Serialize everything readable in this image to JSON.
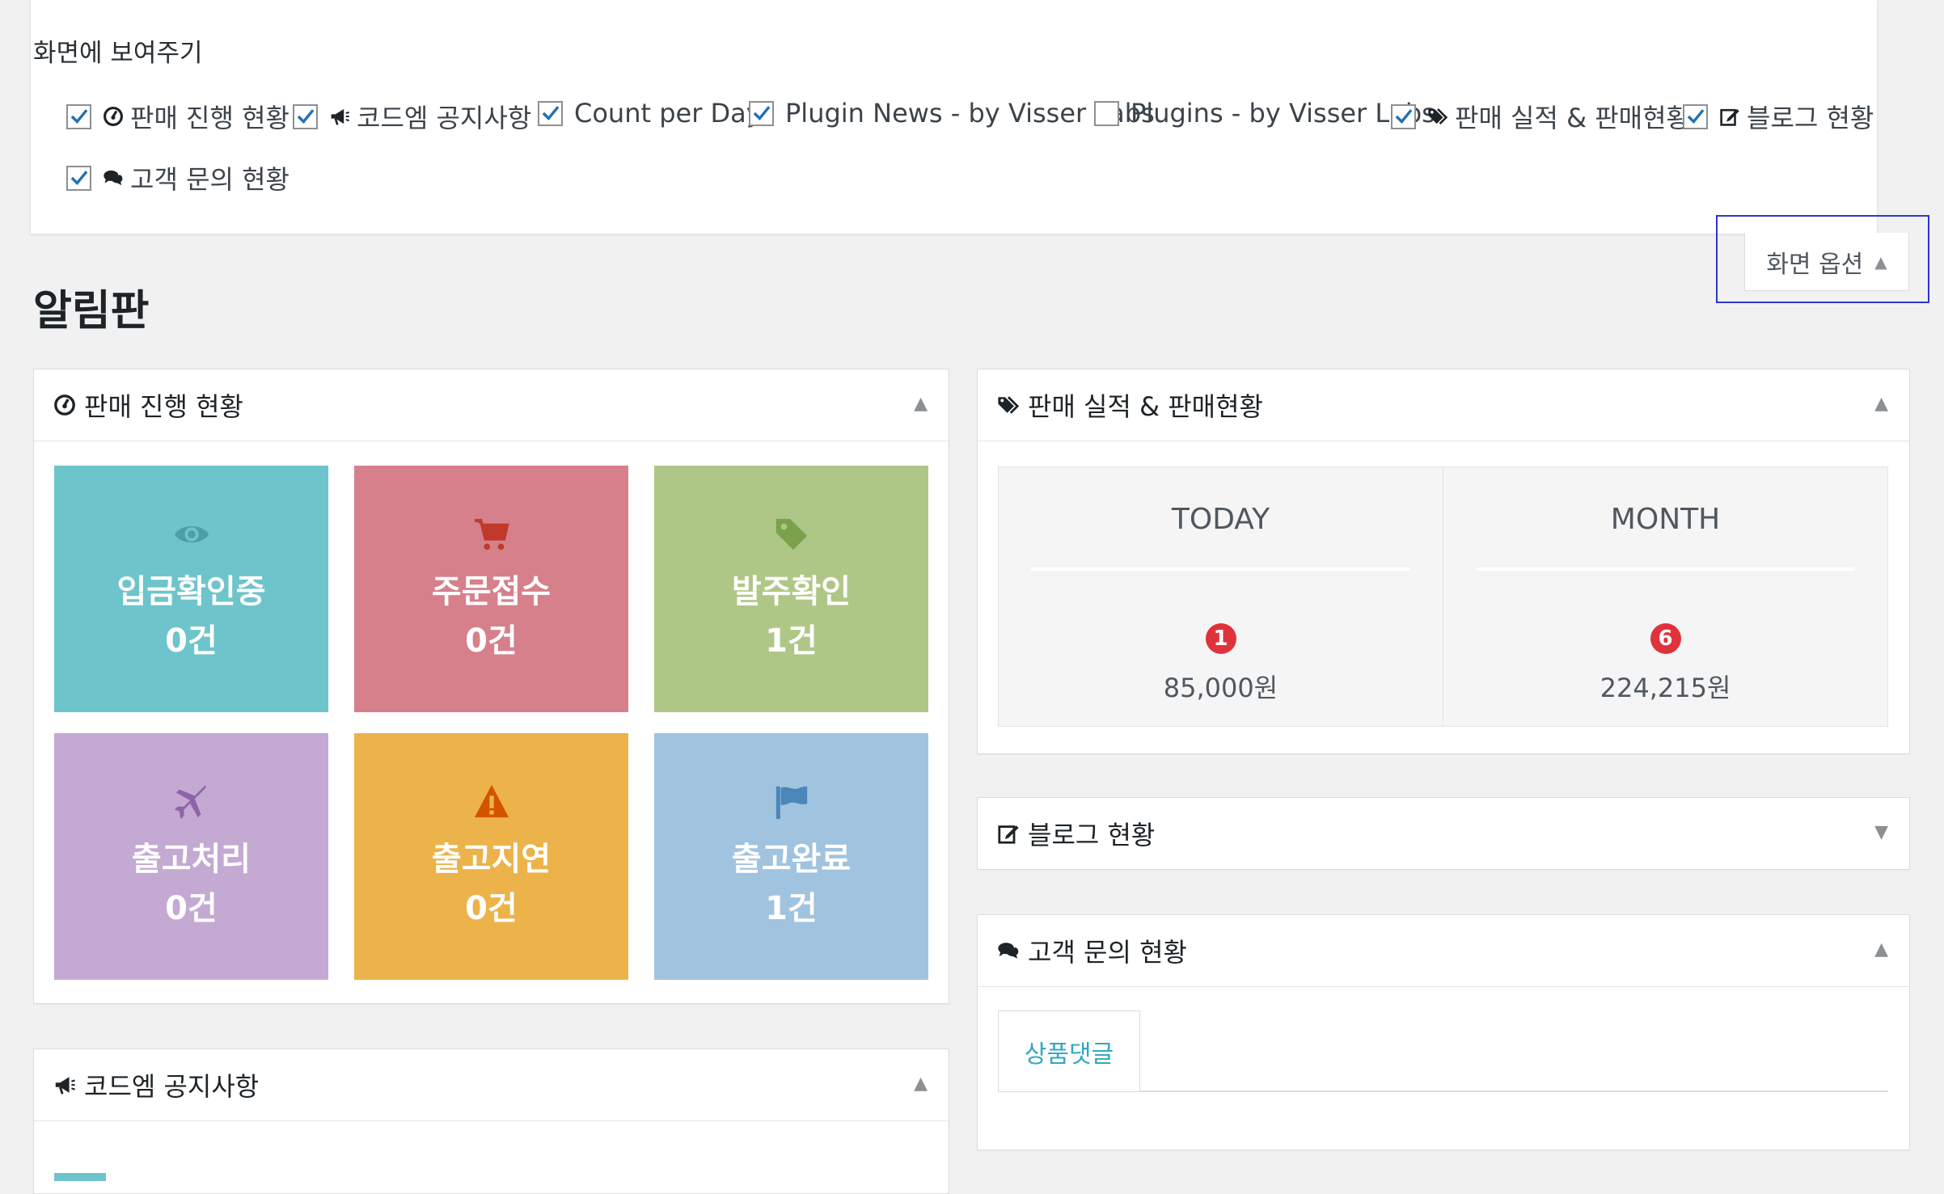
{
  "screen_options": {
    "title": "화면에 보여주기",
    "options": [
      {
        "label": "판매 진행 현황",
        "checked": true,
        "icon": "dashboard-icon"
      },
      {
        "label": "코드엠 공지사항",
        "checked": true,
        "icon": "bullhorn-icon"
      },
      {
        "label": "Count per Day",
        "checked": true,
        "icon": null
      },
      {
        "label": "Plugin News - by Visser Labs",
        "checked": true,
        "icon": null
      },
      {
        "label": "Plugins - by Visser Labs",
        "checked": false,
        "icon": null
      },
      {
        "label": "판매 실적 & 판매현황",
        "checked": true,
        "icon": "tags-icon"
      },
      {
        "label": "블로그 현황",
        "checked": true,
        "icon": "edit-icon"
      },
      {
        "label": "고객 문의 현황",
        "checked": true,
        "icon": "comments-icon"
      }
    ],
    "tab_label": "화면 옵션",
    "tab_arrow": "▲"
  },
  "page_title": "알림판",
  "sales_progress": {
    "title": "판매 진행 현황",
    "toggle": "▲",
    "tiles": [
      {
        "label": "입금확인중",
        "count": "0건",
        "color": "#6ec4cb",
        "icon_color": "#4f9ea6",
        "icon": "eye-icon"
      },
      {
        "label": "주문접수",
        "count": "0건",
        "color": "#d6808c",
        "icon_color": "#c0392b",
        "icon": "cart-icon"
      },
      {
        "label": "발주확인",
        "count": "1건",
        "color": "#afc786",
        "icon_color": "#7aa14b",
        "icon": "tag-icon"
      },
      {
        "label": "출고처리",
        "count": "0건",
        "color": "#c4a9d3",
        "icon_color": "#8e64a8",
        "icon": "plane-icon"
      },
      {
        "label": "출고지연",
        "count": "0건",
        "color": "#ecb34a",
        "icon_color": "#d35400",
        "icon": "warning-icon"
      },
      {
        "label": "출고완료",
        "count": "1건",
        "color": "#a0c3df",
        "icon_color": "#4b86b9",
        "icon": "flag-icon"
      }
    ]
  },
  "notice": {
    "title": "코드엠 공지사항",
    "toggle": "▲"
  },
  "sales_report": {
    "title": "판매 실적 & 판매현황",
    "toggle": "▲",
    "today": {
      "label": "TODAY",
      "badge": "1",
      "amount": "85,000원"
    },
    "month": {
      "label": "MONTH",
      "badge": "6",
      "amount": "224,215원"
    }
  },
  "blog": {
    "title": "블로그 현황",
    "toggle": "▼"
  },
  "customer_inquiry": {
    "title": "고객 문의 현황",
    "toggle": "▲",
    "tab_label": "상품댓글"
  }
}
